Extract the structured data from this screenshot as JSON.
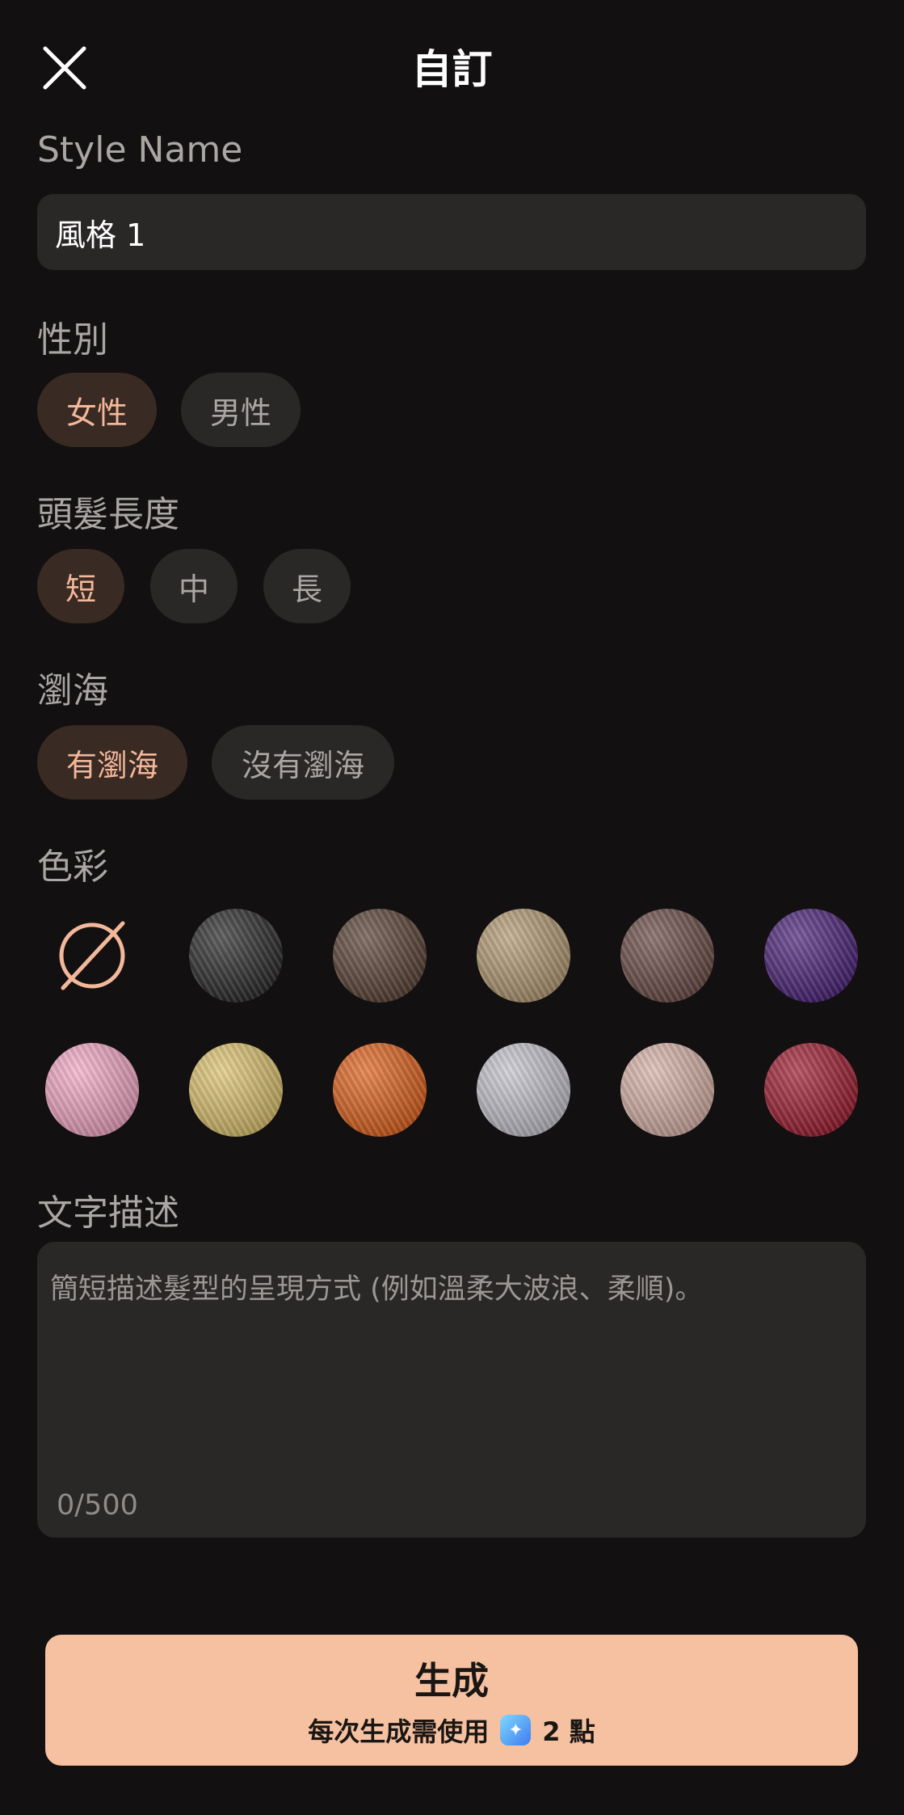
{
  "header": {
    "title": "自訂",
    "close_icon": "close-icon"
  },
  "style_name": {
    "label": "Style Name",
    "value": "風格 1"
  },
  "gender": {
    "label": "性別",
    "options": [
      "女性",
      "男性"
    ],
    "selected": "女性"
  },
  "hair_length": {
    "label": "頭髮長度",
    "options": [
      "短",
      "中",
      "長"
    ],
    "selected": "短"
  },
  "bangs": {
    "label": "瀏海",
    "options": [
      "有瀏海",
      "沒有瀏海"
    ],
    "selected": "有瀏海"
  },
  "color": {
    "label": "色彩",
    "swatches": [
      {
        "name": "none",
        "hex": "none"
      },
      {
        "name": "black",
        "hex": "#2a2a2c"
      },
      {
        "name": "dark-brown",
        "hex": "#5a4336"
      },
      {
        "name": "ash-blonde",
        "hex": "#b39a74"
      },
      {
        "name": "mauve-brown",
        "hex": "#6a4c46"
      },
      {
        "name": "purple",
        "hex": "#4a2378"
      },
      {
        "name": "pink",
        "hex": "#f2a7c4"
      },
      {
        "name": "golden-blonde",
        "hex": "#dcc36e"
      },
      {
        "name": "orange",
        "hex": "#e0621e"
      },
      {
        "name": "silver",
        "hex": "#c4c4cc"
      },
      {
        "name": "rose-beige",
        "hex": "#d8b2a8"
      },
      {
        "name": "burgundy",
        "hex": "#9e1e32"
      }
    ]
  },
  "description": {
    "label": "文字描述",
    "placeholder": "簡短描述髮型的呈現方式 (例如溫柔大波浪、柔順)。",
    "counter": "0/500"
  },
  "generate": {
    "label": "生成",
    "sub_prefix": "每次生成需使用",
    "cost": "2 點",
    "icon": "gem-icon"
  },
  "colors": {
    "background": "#121010",
    "field": "#2a2727",
    "accent": "#f6c1a1",
    "selected_chip": "#3a2a24",
    "selected_text": "#f3b89a"
  }
}
